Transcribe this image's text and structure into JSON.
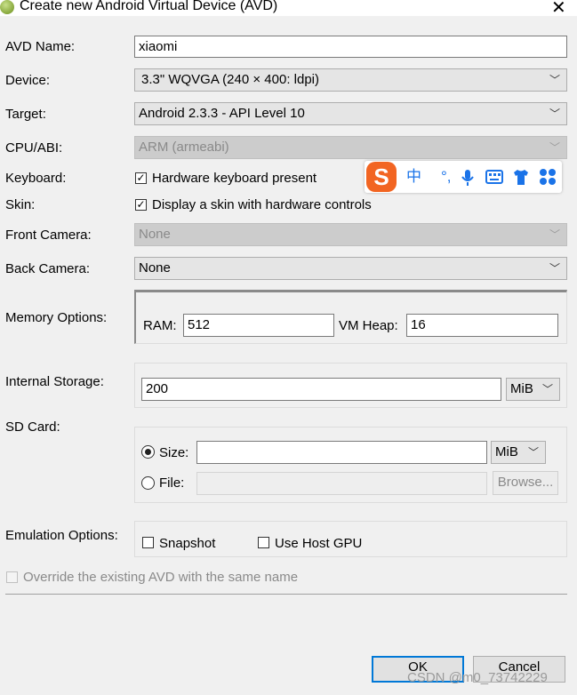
{
  "window": {
    "title": "Create new Android Virtual Device (AVD)",
    "close_glyph": "✕"
  },
  "avd_name": {
    "label": "AVD Name:",
    "value": "xiaomi"
  },
  "device": {
    "label": "Device:",
    "value": "3.3\" WQVGA (240 × 400: ldpi)"
  },
  "target": {
    "label": "Target:",
    "value": "Android 2.3.3 - API Level 10"
  },
  "cpu_abi": {
    "label": "CPU/ABI:",
    "value": "ARM (armeabi)",
    "enabled": false
  },
  "keyboard": {
    "label": "Keyboard:",
    "checkbox_label": "Hardware keyboard present",
    "checked": true
  },
  "skin": {
    "label": "Skin:",
    "checkbox_label": "Display a skin with hardware controls",
    "checked": true
  },
  "front_camera": {
    "label": "Front Camera:",
    "value": "None",
    "enabled": false
  },
  "back_camera": {
    "label": "Back Camera:",
    "value": "None"
  },
  "memory": {
    "label": "Memory Options:",
    "ram_label": "RAM:",
    "ram_value": "512",
    "vmheap_label": "VM Heap:",
    "vmheap_value": "16"
  },
  "internal_storage": {
    "label": "Internal Storage:",
    "value": "200",
    "unit": "MiB"
  },
  "sd_card": {
    "label": "SD Card:",
    "size_label": "Size:",
    "size_value": "",
    "size_unit": "MiB",
    "file_label": "File:",
    "file_value": "",
    "browse_label": "Browse...",
    "selected": "size"
  },
  "emulation": {
    "label": "Emulation Options:",
    "snapshot_label": "Snapshot",
    "snapshot_checked": false,
    "gpu_label": "Use Host GPU",
    "gpu_checked": false
  },
  "override": {
    "label": "Override the existing AVD with the same name",
    "checked": false,
    "enabled": false
  },
  "buttons": {
    "ok": "OK",
    "cancel": "Cancel"
  },
  "ime_toolbar": {
    "logo": "S",
    "lang": "中",
    "punct": "°,",
    "icons": [
      "microphone-icon",
      "keyboard-icon",
      "shirt-icon",
      "grid-icon"
    ]
  },
  "watermark": "CSDN @m0_73742229",
  "colors": {
    "default_button_border": "#0078d7",
    "ime_logo": "#f26522",
    "ime_icons": "#1a73e8"
  }
}
